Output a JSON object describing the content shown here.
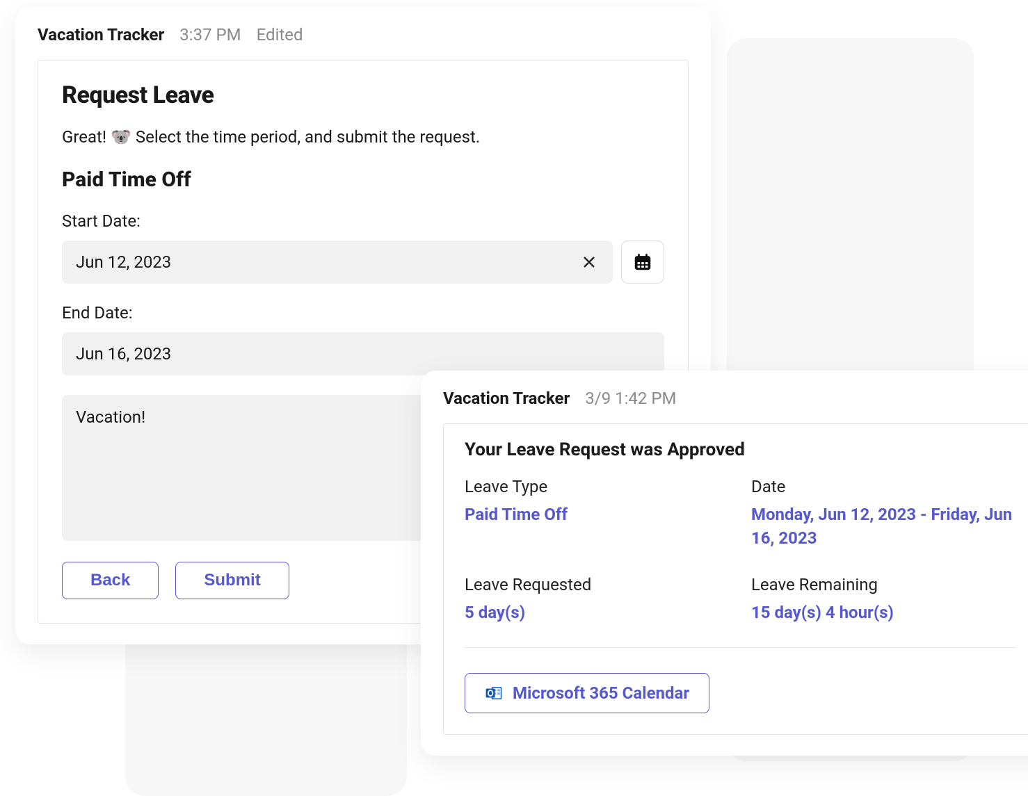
{
  "request_card": {
    "app_name": "Vacation Tracker",
    "timestamp": "3:37 PM",
    "edited_label": "Edited",
    "title": "Request Leave",
    "intro_prefix": "Great! ",
    "intro_emoji": "🐨",
    "intro_suffix": " Select the time period, and submit the request.",
    "subtitle": "Paid Time Off",
    "start_date_label": "Start Date:",
    "start_date_value": "Jun 12, 2023",
    "end_date_label": "End Date:",
    "end_date_value": "Jun 16, 2023",
    "note_value": "Vacation!",
    "back_button": "Back",
    "submit_button": "Submit"
  },
  "approval_card": {
    "app_name": "Vacation Tracker",
    "timestamp": "3/9 1:42 PM",
    "title": "Your Leave Request was Approved",
    "leave_type_label": "Leave Type",
    "leave_type_value": "Paid Time Off",
    "date_label": "Date",
    "date_value": "Monday, Jun 12, 2023 - Friday, Jun 16, 2023",
    "leave_requested_label": "Leave Requested",
    "leave_requested_value": "5 day(s)",
    "leave_remaining_label": "Leave Remaining",
    "leave_remaining_value": "15 day(s) 4 hour(s)",
    "calendar_button": "Microsoft 365 Calendar"
  }
}
